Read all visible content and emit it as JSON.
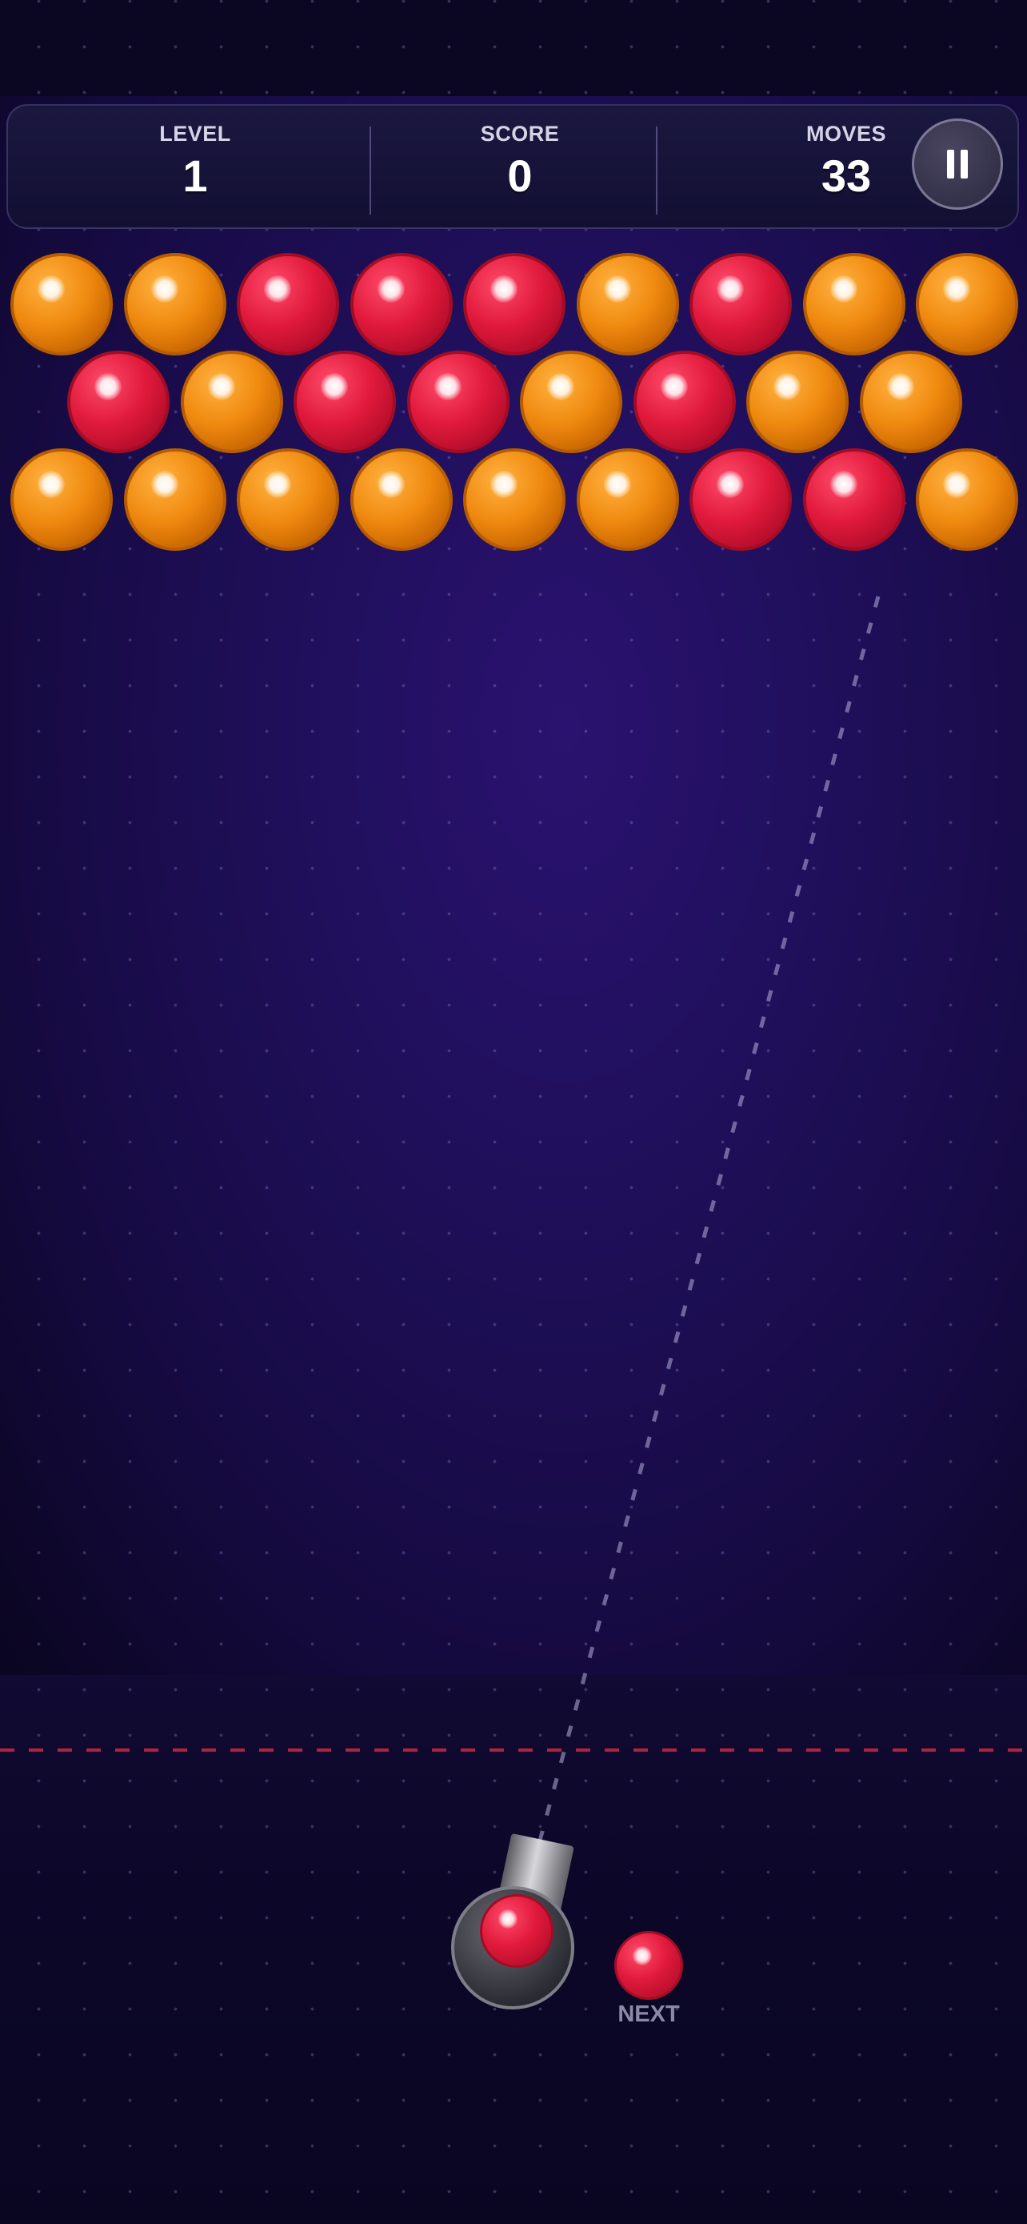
{
  "hud": {
    "level_label": "LEVEL",
    "level_value": "1",
    "score_label": "SCORE",
    "score_value": "0",
    "moves_label": "MOVES",
    "moves_value": "33",
    "pause_icon": "pause-icon"
  },
  "board": {
    "rows": [
      [
        "orange",
        "orange",
        "red",
        "red",
        "red",
        "orange",
        "red",
        "orange",
        "orange"
      ],
      [
        "red",
        "orange",
        "red",
        "red",
        "orange",
        "red",
        "orange",
        "orange"
      ],
      [
        "orange",
        "orange",
        "orange",
        "orange",
        "orange",
        "orange",
        "red",
        "red",
        "orange"
      ]
    ],
    "colors": {
      "orange": "#f08a10",
      "red": "#e11a3c"
    }
  },
  "shooter": {
    "current_bubble": "red",
    "next_bubble": "red",
    "next_label": "NEXT"
  },
  "theme": {
    "background": "#1f0f5a",
    "deadline_color": "#b0243e"
  }
}
